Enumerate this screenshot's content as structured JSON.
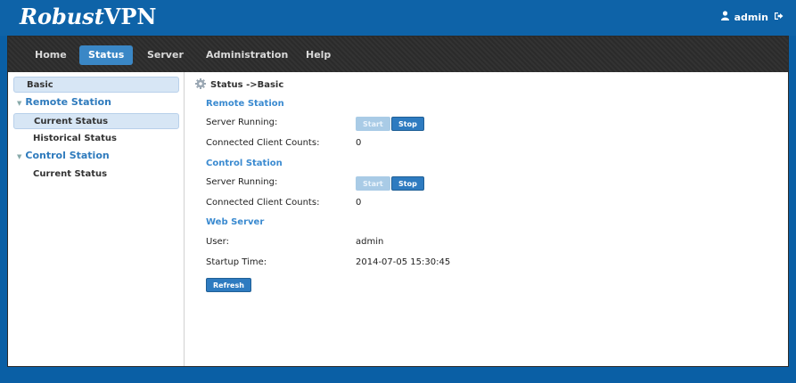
{
  "app": {
    "logo_italic": "Robust",
    "logo_rest": "VPN",
    "user": "admin"
  },
  "nav": [
    "Home",
    "Status",
    "Server",
    "Administration",
    "Help"
  ],
  "sidebar": {
    "basic": "Basic",
    "remote_station": "Remote Station",
    "remote_current": "Current Status",
    "remote_historical": "Historical Status",
    "control_station": "Control Station",
    "control_current": "Current Status"
  },
  "breadcrumb": "Status ->Basic",
  "remote": {
    "title": "Remote Station",
    "server_running_label": "Server Running:",
    "start": "Start",
    "stop": "Stop",
    "client_counts_label": "Connected Client Counts:",
    "client_counts": "0"
  },
  "control": {
    "title": "Control Station",
    "server_running_label": "Server Running:",
    "start": "Start",
    "stop": "Stop",
    "client_counts_label": "Connected Client Counts:",
    "client_counts": "0"
  },
  "web": {
    "title": "Web Server",
    "user_label": "User:",
    "user": "admin",
    "startup_label": "Startup Time:",
    "startup": "2014-07-05 15:30:45"
  },
  "refresh": "Refresh"
}
